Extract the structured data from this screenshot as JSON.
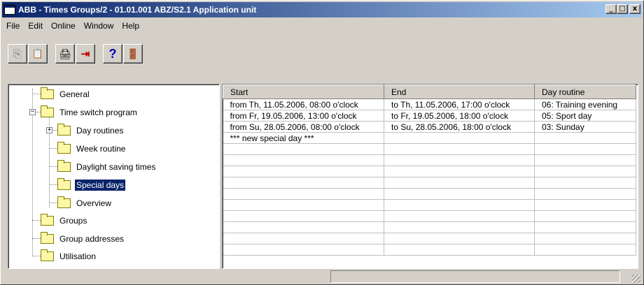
{
  "window": {
    "title": "ABB - Times Groups/2 - 01.01.001 ABZ/S2.1 Application unit",
    "minimize_glyph": "_",
    "maximize_glyph": "□",
    "close_glyph": "x"
  },
  "menu": [
    {
      "label": "File"
    },
    {
      "label": "Edit"
    },
    {
      "label": "Online"
    },
    {
      "label": "Window"
    },
    {
      "label": "Help"
    }
  ],
  "toolbar": [
    {
      "icon": "copy-icon",
      "glyph": "⎘"
    },
    {
      "icon": "paste-icon",
      "glyph": "📋"
    },
    {
      "icon": "print-icon",
      "glyph": "🖨"
    },
    {
      "icon": "download-icon",
      "glyph": "⇥"
    },
    {
      "icon": "help-icon",
      "glyph": "?"
    },
    {
      "icon": "exit-icon",
      "glyph": "🚪"
    }
  ],
  "tree": {
    "items": [
      {
        "label": "General"
      },
      {
        "label": "Time switch program",
        "expander": "−"
      },
      {
        "label": "Day routines",
        "expander": "+"
      },
      {
        "label": "Week routine"
      },
      {
        "label": "Daylight saving times"
      },
      {
        "label": "Special days",
        "selected": true
      },
      {
        "label": "Overview"
      },
      {
        "label": "Groups"
      },
      {
        "label": "Group addresses"
      },
      {
        "label": "Utilisation"
      }
    ]
  },
  "grid": {
    "columns": [
      "Start",
      "End",
      "Day routine"
    ],
    "rows": [
      [
        "from Th, 11.05.2006, 08:00 o'clock",
        "to Th, 11.05.2006, 17:00 o'clock",
        "06: Training evening"
      ],
      [
        "from Fr, 19.05.2006, 13:00 o'clock",
        "to Fr, 19.05.2006, 18:00 o'clock",
        "05: Sport day"
      ],
      [
        "from Su, 28.05.2006, 08:00 o'clock",
        "to Su, 28.05.2006, 18:00 o'clock",
        "03: Sunday"
      ],
      [
        "*** new special day ***",
        "",
        ""
      ],
      [
        "",
        "",
        ""
      ],
      [
        "",
        "",
        ""
      ],
      [
        "",
        "",
        ""
      ],
      [
        "",
        "",
        ""
      ],
      [
        "",
        "",
        ""
      ],
      [
        "",
        "",
        ""
      ],
      [
        "",
        "",
        ""
      ],
      [
        "",
        "",
        ""
      ],
      [
        "",
        "",
        ""
      ],
      [
        "",
        "",
        ""
      ]
    ]
  },
  "status": {
    "text": ""
  }
}
